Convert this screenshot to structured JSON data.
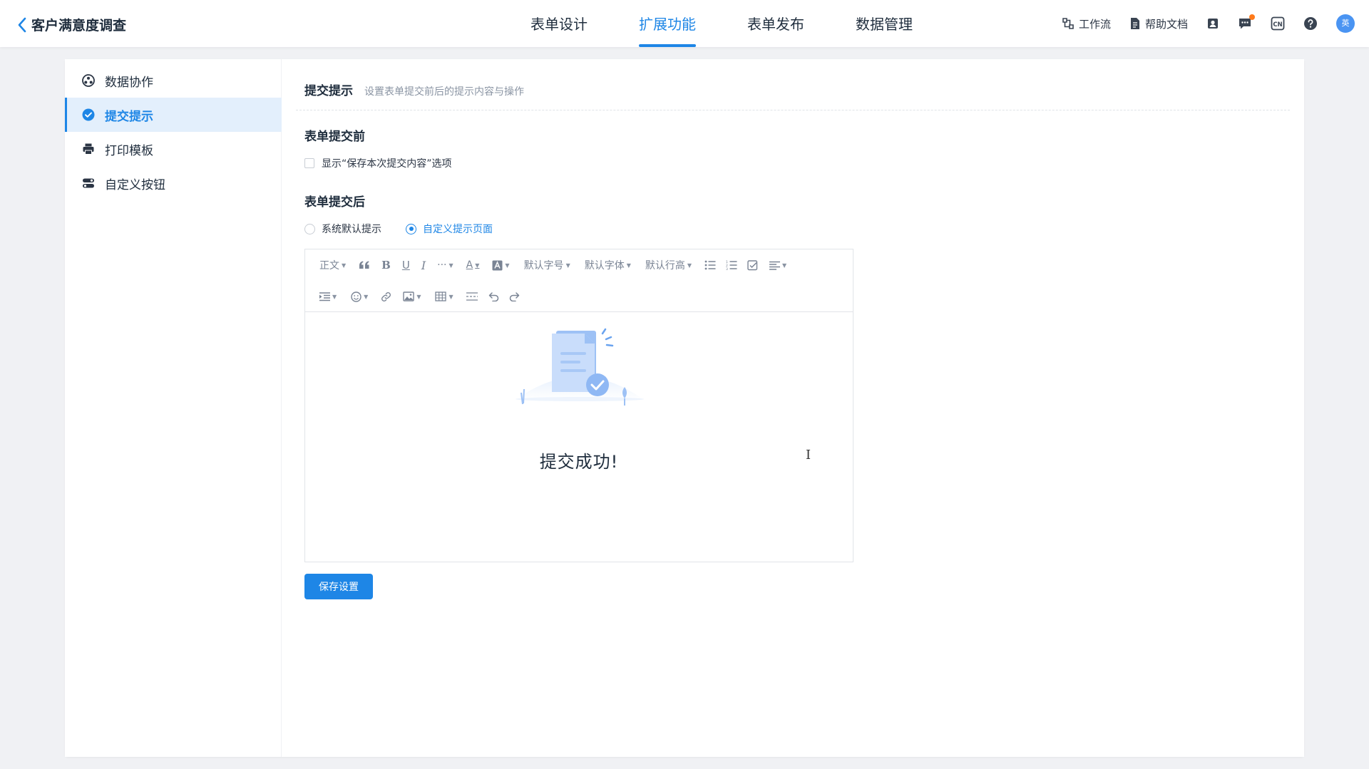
{
  "header": {
    "back_icon": "chevron-left-icon",
    "title": "客户满意度调查",
    "tabs": [
      {
        "label": "表单设计",
        "active": false
      },
      {
        "label": "扩展功能",
        "active": true
      },
      {
        "label": "表单发布",
        "active": false
      },
      {
        "label": "数据管理",
        "active": false
      }
    ],
    "tools": {
      "workflow_label": "工作流",
      "help_label": "帮助文档",
      "lang_label": "CN",
      "avatar_text": "英"
    }
  },
  "sidebar": {
    "items": [
      {
        "label": "数据协作",
        "icon": "share-icon",
        "active": false
      },
      {
        "label": "提交提示",
        "icon": "check-circle-icon",
        "active": true
      },
      {
        "label": "打印模板",
        "icon": "printer-icon",
        "active": false
      },
      {
        "label": "自定义按钮",
        "icon": "toggle-icon",
        "active": false
      }
    ]
  },
  "section": {
    "title": "提交提示",
    "desc": "设置表单提交前后的提示内容与操作",
    "before": {
      "title": "表单提交前",
      "checkbox_label": "显示“保存本次提交内容”选项",
      "checked": false
    },
    "after": {
      "title": "表单提交后",
      "options": [
        {
          "label": "系统默认提示",
          "selected": false
        },
        {
          "label": "自定义提示页面",
          "selected": true
        }
      ]
    }
  },
  "editor": {
    "toolbar": {
      "paragraph": "正文",
      "font_size": "默认字号",
      "font_family": "默认字体",
      "line_height": "默认行高",
      "more": "···",
      "bold": "B",
      "underline": "U",
      "italic": "I",
      "font_color": "A"
    },
    "content_text": "提交成功!",
    "illustration": "document-check-illustration"
  },
  "save_button": "保存设置",
  "colors": {
    "accent": "#1e86e6",
    "background": "#f0f1f4",
    "active_bg": "#e3effc"
  }
}
